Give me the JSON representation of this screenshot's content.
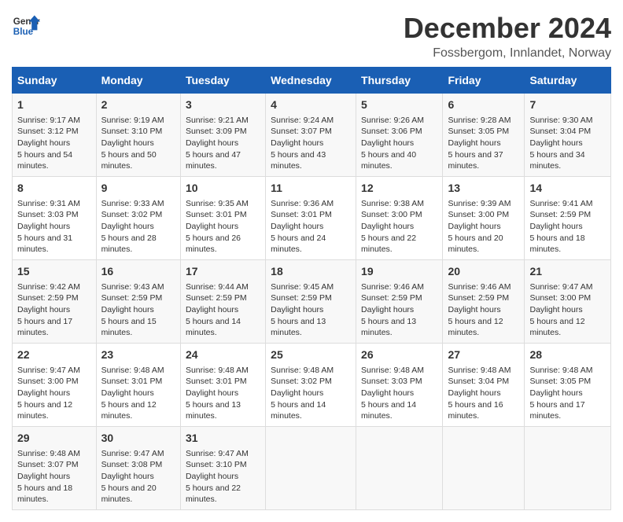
{
  "logo": {
    "line1": "General",
    "line2": "Blue"
  },
  "title": "December 2024",
  "subtitle": "Fossbergom, Innlandet, Norway",
  "days_of_week": [
    "Sunday",
    "Monday",
    "Tuesday",
    "Wednesday",
    "Thursday",
    "Friday",
    "Saturday"
  ],
  "weeks": [
    [
      {
        "day": "1",
        "sunrise": "9:17 AM",
        "sunset": "3:12 PM",
        "daylight": "5 hours and 54 minutes."
      },
      {
        "day": "2",
        "sunrise": "9:19 AM",
        "sunset": "3:10 PM",
        "daylight": "5 hours and 50 minutes."
      },
      {
        "day": "3",
        "sunrise": "9:21 AM",
        "sunset": "3:09 PM",
        "daylight": "5 hours and 47 minutes."
      },
      {
        "day": "4",
        "sunrise": "9:24 AM",
        "sunset": "3:07 PM",
        "daylight": "5 hours and 43 minutes."
      },
      {
        "day": "5",
        "sunrise": "9:26 AM",
        "sunset": "3:06 PM",
        "daylight": "5 hours and 40 minutes."
      },
      {
        "day": "6",
        "sunrise": "9:28 AM",
        "sunset": "3:05 PM",
        "daylight": "5 hours and 37 minutes."
      },
      {
        "day": "7",
        "sunrise": "9:30 AM",
        "sunset": "3:04 PM",
        "daylight": "5 hours and 34 minutes."
      }
    ],
    [
      {
        "day": "8",
        "sunrise": "9:31 AM",
        "sunset": "3:03 PM",
        "daylight": "5 hours and 31 minutes."
      },
      {
        "day": "9",
        "sunrise": "9:33 AM",
        "sunset": "3:02 PM",
        "daylight": "5 hours and 28 minutes."
      },
      {
        "day": "10",
        "sunrise": "9:35 AM",
        "sunset": "3:01 PM",
        "daylight": "5 hours and 26 minutes."
      },
      {
        "day": "11",
        "sunrise": "9:36 AM",
        "sunset": "3:01 PM",
        "daylight": "5 hours and 24 minutes."
      },
      {
        "day": "12",
        "sunrise": "9:38 AM",
        "sunset": "3:00 PM",
        "daylight": "5 hours and 22 minutes."
      },
      {
        "day": "13",
        "sunrise": "9:39 AM",
        "sunset": "3:00 PM",
        "daylight": "5 hours and 20 minutes."
      },
      {
        "day": "14",
        "sunrise": "9:41 AM",
        "sunset": "2:59 PM",
        "daylight": "5 hours and 18 minutes."
      }
    ],
    [
      {
        "day": "15",
        "sunrise": "9:42 AM",
        "sunset": "2:59 PM",
        "daylight": "5 hours and 17 minutes."
      },
      {
        "day": "16",
        "sunrise": "9:43 AM",
        "sunset": "2:59 PM",
        "daylight": "5 hours and 15 minutes."
      },
      {
        "day": "17",
        "sunrise": "9:44 AM",
        "sunset": "2:59 PM",
        "daylight": "5 hours and 14 minutes."
      },
      {
        "day": "18",
        "sunrise": "9:45 AM",
        "sunset": "2:59 PM",
        "daylight": "5 hours and 13 minutes."
      },
      {
        "day": "19",
        "sunrise": "9:46 AM",
        "sunset": "2:59 PM",
        "daylight": "5 hours and 13 minutes."
      },
      {
        "day": "20",
        "sunrise": "9:46 AM",
        "sunset": "2:59 PM",
        "daylight": "5 hours and 12 minutes."
      },
      {
        "day": "21",
        "sunrise": "9:47 AM",
        "sunset": "3:00 PM",
        "daylight": "5 hours and 12 minutes."
      }
    ],
    [
      {
        "day": "22",
        "sunrise": "9:47 AM",
        "sunset": "3:00 PM",
        "daylight": "5 hours and 12 minutes."
      },
      {
        "day": "23",
        "sunrise": "9:48 AM",
        "sunset": "3:01 PM",
        "daylight": "5 hours and 12 minutes."
      },
      {
        "day": "24",
        "sunrise": "9:48 AM",
        "sunset": "3:01 PM",
        "daylight": "5 hours and 13 minutes."
      },
      {
        "day": "25",
        "sunrise": "9:48 AM",
        "sunset": "3:02 PM",
        "daylight": "5 hours and 14 minutes."
      },
      {
        "day": "26",
        "sunrise": "9:48 AM",
        "sunset": "3:03 PM",
        "daylight": "5 hours and 14 minutes."
      },
      {
        "day": "27",
        "sunrise": "9:48 AM",
        "sunset": "3:04 PM",
        "daylight": "5 hours and 16 minutes."
      },
      {
        "day": "28",
        "sunrise": "9:48 AM",
        "sunset": "3:05 PM",
        "daylight": "5 hours and 17 minutes."
      }
    ],
    [
      {
        "day": "29",
        "sunrise": "9:48 AM",
        "sunset": "3:07 PM",
        "daylight": "5 hours and 18 minutes."
      },
      {
        "day": "30",
        "sunrise": "9:47 AM",
        "sunset": "3:08 PM",
        "daylight": "5 hours and 20 minutes."
      },
      {
        "day": "31",
        "sunrise": "9:47 AM",
        "sunset": "3:10 PM",
        "daylight": "5 hours and 22 minutes."
      },
      null,
      null,
      null,
      null
    ]
  ],
  "labels": {
    "sunrise": "Sunrise:",
    "sunset": "Sunset:",
    "daylight": "Daylight hours"
  }
}
